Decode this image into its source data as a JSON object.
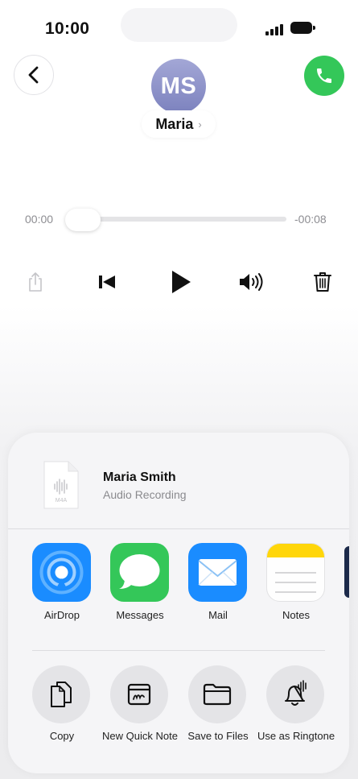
{
  "status_bar": {
    "time": "10:00"
  },
  "header": {
    "avatar_initials": "MS",
    "contact_name": "Maria",
    "name_chevron": "›",
    "back_icon": "chevron-left-icon",
    "call_icon": "phone-icon",
    "call_color": "#34c759"
  },
  "player": {
    "elapsed": "00:00",
    "remaining": "-00:08",
    "progress_fraction": 0
  },
  "controls": [
    "share-icon",
    "skip-back-icon",
    "play-icon",
    "speaker-icon",
    "trash-icon"
  ],
  "share_sheet": {
    "file_title": "Maria Smith",
    "file_subtitle": "Audio Recording",
    "file_badge": "M4A",
    "apps": [
      {
        "label": "AirDrop",
        "icon": "airdrop-icon",
        "color": "#1a8cff"
      },
      {
        "label": "Messages",
        "icon": "messages-icon",
        "color": "#34c759"
      },
      {
        "label": "Mail",
        "icon": "mail-icon",
        "color": "#1a8cff"
      },
      {
        "label": "Notes",
        "icon": "notes-icon",
        "color": "#ffd60a"
      }
    ],
    "actions": [
      {
        "label": "Copy",
        "icon": "copy-icon"
      },
      {
        "label": "New Quick Note",
        "icon": "quick-note-icon"
      },
      {
        "label": "Save to Files",
        "icon": "folder-icon"
      },
      {
        "label": "Use as Ringtone",
        "icon": "ringtone-bell-icon"
      }
    ]
  }
}
